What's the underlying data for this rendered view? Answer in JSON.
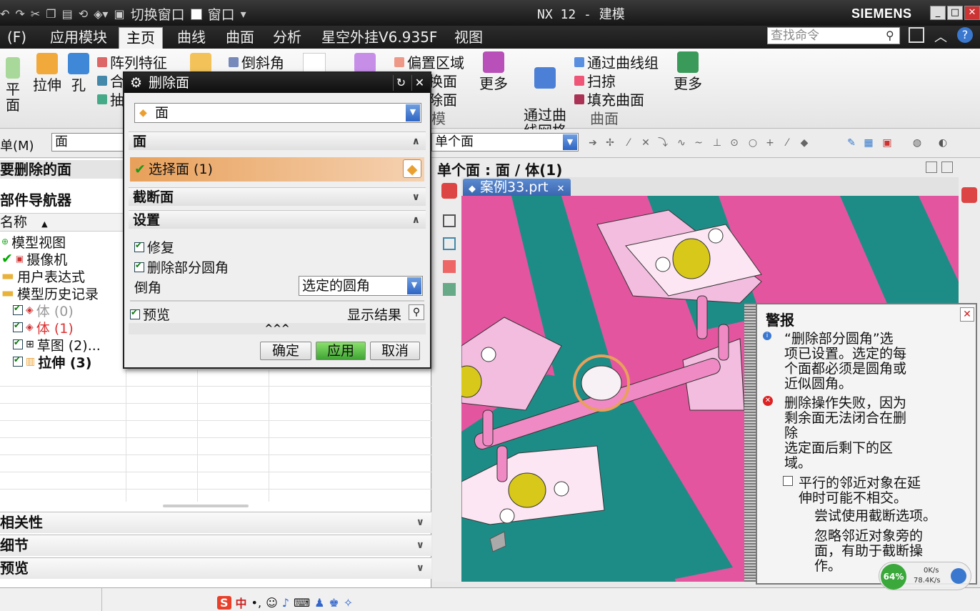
{
  "window": {
    "quick_access": [
      "切换窗口",
      "窗口"
    ],
    "title": "NX 12 - 建模",
    "brand": "SIEMENS"
  },
  "menu": {
    "file": "(F)",
    "tabs": [
      "应用模块",
      "主页",
      "曲线",
      "曲面",
      "分析",
      "星空外挂V6.935F",
      "视图"
    ],
    "active": "主页",
    "search_placeholder": "查找命令"
  },
  "ribbon": {
    "big_buttons": [
      "平面",
      "拉伸",
      "孔",
      "更多",
      "通过曲\n线网格",
      "更多"
    ],
    "feature_items": [
      "阵列特征",
      "合",
      "抽"
    ],
    "chamfer": "倒斜角",
    "sync_items": [
      "偏置区域",
      "换面",
      "除面",
      "模"
    ],
    "surface_items": [
      "通过曲线组",
      "扫掠",
      "填充曲面"
    ],
    "group_surface": "曲面"
  },
  "filterbar": {
    "menu_label": "单(M)",
    "type_filter": "面",
    "select_rule": "单个面"
  },
  "navigator": {
    "prompt": "要删除的面",
    "title": "部件导航器",
    "column_name": "名称",
    "rows": [
      {
        "label": "模型视图"
      },
      {
        "label": "摄像机"
      },
      {
        "label": "用户表达式"
      },
      {
        "label": "模型历史记录"
      },
      {
        "label": "体 (0)"
      },
      {
        "label": "体 (1)"
      },
      {
        "label": "草图 (2)..."
      },
      {
        "label": "拉伸 (3)"
      }
    ],
    "panels": [
      "相关性",
      "细节",
      "预览"
    ]
  },
  "viewbar": {
    "status": "单个面 : 面 / 体(1)",
    "doc_tab": "案例33.prt"
  },
  "dialog": {
    "title": "删除面",
    "type_value": "面",
    "sections": {
      "face": "面",
      "select_face": "选择面 (1)",
      "cross_section": "截断面",
      "settings": "设置"
    },
    "repair": "修复",
    "delete_partial_blend": "删除部分圆角",
    "blend_label": "倒角",
    "blend_value": "选定的圆角",
    "preview": "预览",
    "show_result": "显示结果",
    "expand": "^^^",
    "ok": "确定",
    "apply": "应用",
    "cancel": "取消"
  },
  "alert": {
    "title": "警报",
    "info": "“删除部分圆角”选\n项已设置。选定的每\n个面都必须是圆角或\n近似圆角。",
    "error": "删除操作失败，因为\n剩余面无法闭合在删\n除\n选定面后剩下的区\n域。",
    "option": "平行的邻近对象在延\n伸时可能不相交。",
    "hint1": "尝试使用截断选项。",
    "hint2": "忽略邻近对象旁的\n面，有助于截断操\n作。"
  },
  "tray": {
    "percent": "64%",
    "up": "0K/s",
    "down": "78.4K/s",
    "ime": "中"
  },
  "colors": {
    "pink": "#e4559f",
    "teal": "#1e8c86",
    "yellow": "#d8c81a",
    "highlight": "#e8a05a"
  }
}
